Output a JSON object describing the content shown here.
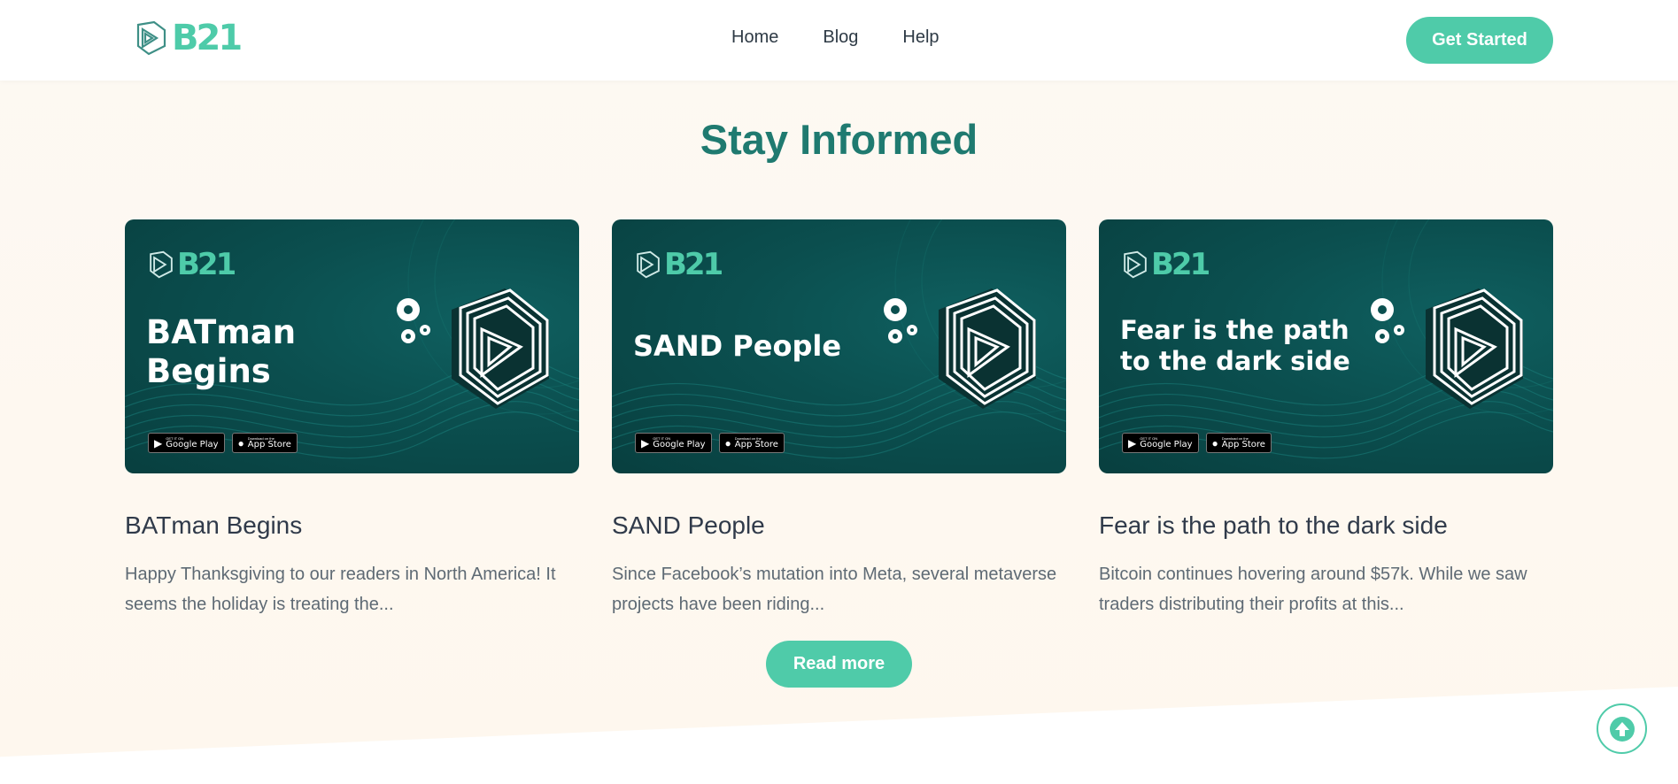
{
  "brand": {
    "logo_text": "B21",
    "accent": "#4fcba9",
    "title_color": "#1f7a70"
  },
  "nav": {
    "items": [
      "Home",
      "Blog",
      "Help"
    ],
    "cta": "Get Started"
  },
  "section": {
    "title": "Stay Informed"
  },
  "cards": [
    {
      "image_title": "BATman Begins",
      "heading": "BATman Begins",
      "excerpt": "Happy Thanksgiving to our readers in North America! It seems the holiday is treating the..."
    },
    {
      "image_title": "SAND People",
      "heading": "SAND People",
      "excerpt": "Since Facebook’s mutation into Meta, several metaverse projects have been riding..."
    },
    {
      "image_title": "Fear is the path to the dark side",
      "heading": "Fear is the path to the dark side",
      "excerpt": "Bitcoin continues hovering around $57k. While we saw traders distributing their profits at this..."
    }
  ],
  "store_badges": {
    "google_small": "GET IT ON",
    "google_big": "Google Play",
    "apple_small": "Download on the",
    "apple_big": "App Store"
  },
  "read_more": "Read more",
  "icons": {
    "scroll_top": "arrow-up-icon",
    "logo": "b21-logo-icon"
  }
}
